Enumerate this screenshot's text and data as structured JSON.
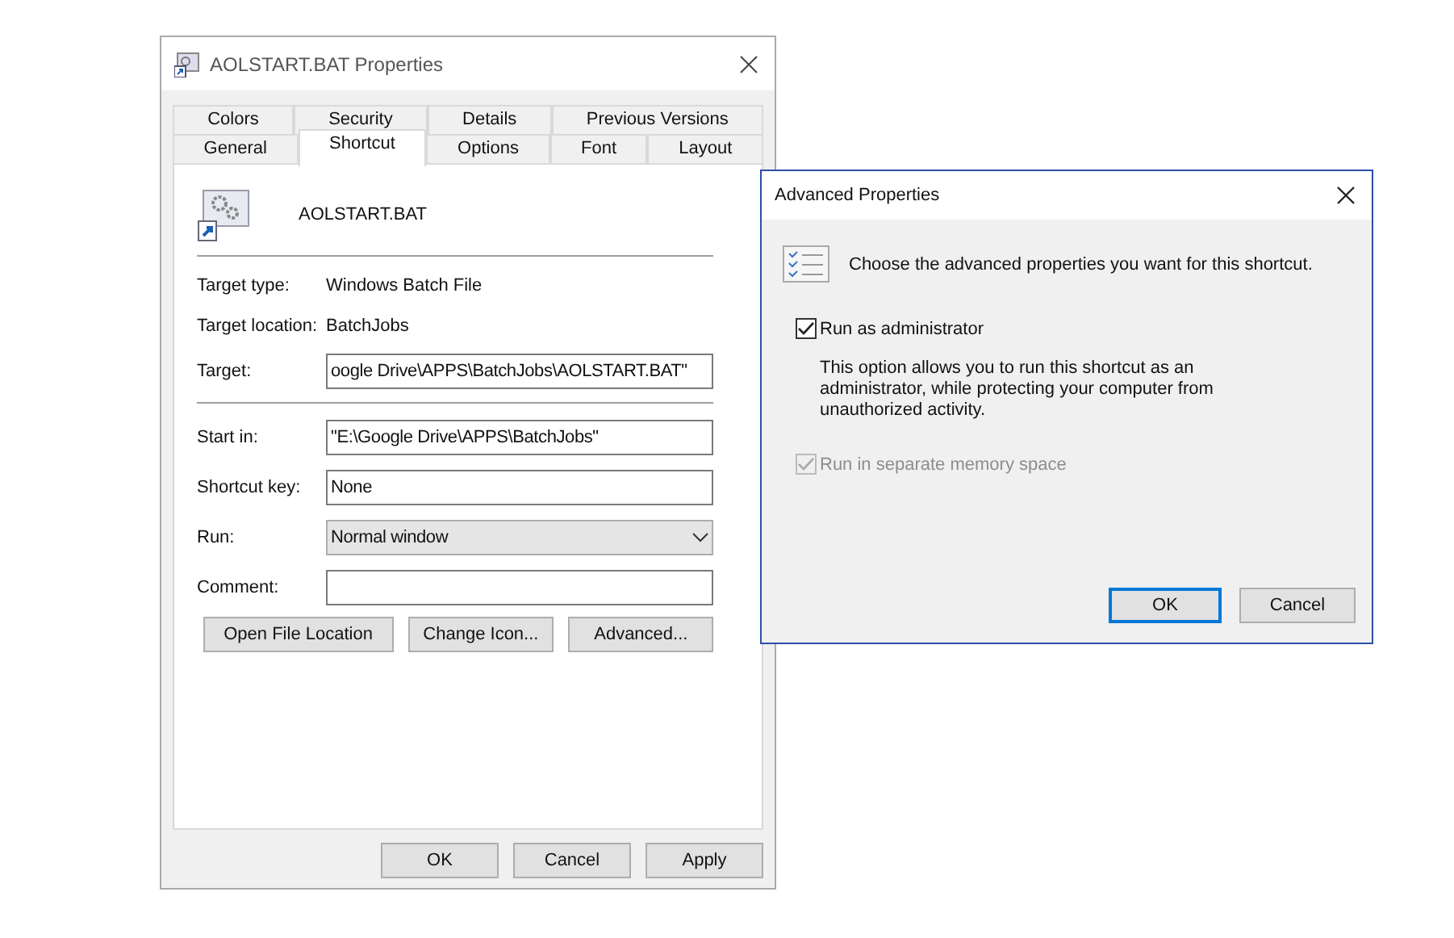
{
  "window": {
    "title": "AOLSTART.BAT Properties"
  },
  "tab_rows": [
    [
      {
        "label": "Colors",
        "selected": false
      },
      {
        "label": "Security",
        "selected": false
      },
      {
        "label": "Details",
        "selected": false
      },
      {
        "label": "Previous Versions",
        "selected": false
      }
    ],
    [
      {
        "label": "General",
        "selected": false
      },
      {
        "label": "Shortcut",
        "selected": true
      },
      {
        "label": "Options",
        "selected": false
      },
      {
        "label": "Font",
        "selected": false
      },
      {
        "label": "Layout",
        "selected": false
      }
    ]
  ],
  "file_name": "AOLSTART.BAT",
  "fields": [
    {
      "kind": "info",
      "label": "Target type:",
      "value": "Windows Batch File"
    },
    {
      "kind": "info",
      "label": "Target location:",
      "value": "BatchJobs"
    },
    {
      "kind": "input",
      "label": "Target:",
      "value": "oogle Drive\\APPS\\BatchJobs\\AOLSTART.BAT\""
    },
    {
      "kind": "divider"
    },
    {
      "kind": "input",
      "label": "Start in:",
      "value": "\"E:\\Google Drive\\APPS\\BatchJobs\""
    },
    {
      "kind": "input",
      "label": "Shortcut key:",
      "value": "None"
    },
    {
      "kind": "dropdown",
      "label": "Run:",
      "value": "Normal window"
    },
    {
      "kind": "input",
      "label": "Comment:"
    }
  ],
  "panel_buttons": [
    "Open File Location",
    "Change Icon...",
    "Advanced..."
  ],
  "buttons": [
    "OK",
    "Cancel",
    "Apply"
  ],
  "advanced_dialog": {
    "title": "Advanced Properties",
    "intro": "Choose the advanced properties you want for this shortcut.",
    "options": [
      {
        "label": "Run as administrator",
        "checked": true,
        "disabled": false,
        "description": "This option allows you to run this shortcut as an administrator, while protecting your computer from unauthorized activity."
      },
      {
        "label": "Run in separate memory space",
        "checked": true,
        "disabled": true
      }
    ],
    "buttons": [
      {
        "label": "OK",
        "default": true
      },
      {
        "label": "Cancel",
        "default": false
      }
    ]
  }
}
